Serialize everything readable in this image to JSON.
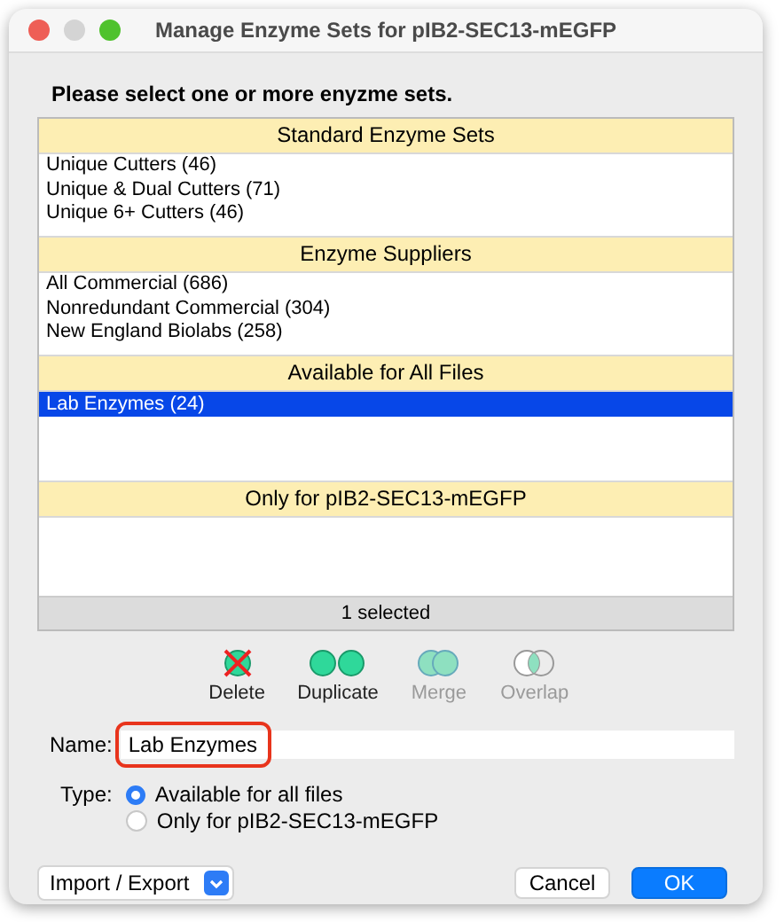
{
  "window": {
    "title": "Manage Enzyme Sets for pIB2-SEC13-mEGFP"
  },
  "prompt": "Please select one or more enyzme sets.",
  "sections": [
    {
      "title": "Standard Enzyme Sets",
      "items": [
        {
          "label": "Unique Cutters  (46)",
          "selected": false
        },
        {
          "label": "Unique & Dual Cutters  (71)",
          "selected": false
        },
        {
          "label": "Unique 6+ Cutters  (46)",
          "selected": false
        }
      ]
    },
    {
      "title": "Enzyme Suppliers",
      "items": [
        {
          "label": "All Commercial  (686)",
          "selected": false
        },
        {
          "label": "Nonredundant Commercial  (304)",
          "selected": false
        },
        {
          "label": "New England Biolabs  (258)",
          "selected": false
        }
      ]
    },
    {
      "title": "Available for All Files",
      "items": [
        {
          "label": "Lab Enzymes  (24)",
          "selected": true
        }
      ]
    },
    {
      "title": "Only for pIB2-SEC13-mEGFP"
    }
  ],
  "status": "1 selected",
  "actions": [
    {
      "kind": "delete",
      "label": "Delete",
      "disabled": false
    },
    {
      "kind": "duplicate",
      "label": "Duplicate",
      "disabled": false
    },
    {
      "kind": "merge",
      "label": "Merge",
      "disabled": true
    },
    {
      "kind": "overlap",
      "label": "Overlap",
      "disabled": true
    }
  ],
  "name_field": {
    "label": "Name:",
    "value": "Lab Enzymes",
    "highlighted": true
  },
  "type": {
    "label": "Type:",
    "options": [
      {
        "label": "Available for all files",
        "selected": true
      },
      {
        "label": "Only for pIB2-SEC13-mEGFP",
        "selected": false
      }
    ]
  },
  "import_export": {
    "label": "Import / Export"
  },
  "buttons": [
    {
      "label": "Cancel",
      "kind": "secondary"
    },
    {
      "label": "OK",
      "kind": "primary"
    }
  ]
}
